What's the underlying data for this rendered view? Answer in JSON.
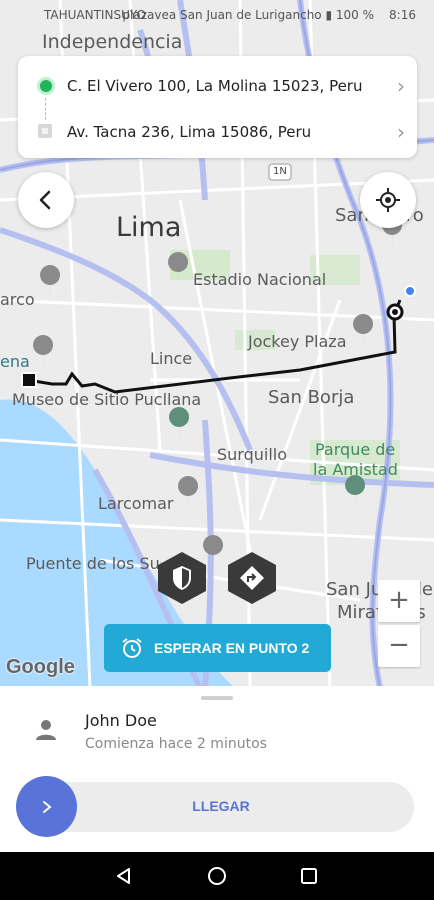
{
  "status_bar": {
    "carrier": "TAHUANTINSUYO",
    "right": "plazavea San Juan de Lurigancho ▮ 100 %",
    "time": "8:16"
  },
  "route": {
    "origin": "C. El Vivero 100, La Molina 15023, Peru",
    "destination": "Av. Tacna 236, Lima 15086, Peru"
  },
  "map": {
    "labels": {
      "independencia": "Independencia",
      "lima": "Lima",
      "san_isidro": "San Isidro",
      "estadio": "Estadio Nacional",
      "arco": "arco",
      "jockey": "Jockey Plaza",
      "lince": "Lince",
      "ena": "ena",
      "museo": "Museo de Sitio Pucllana",
      "san_borja": "San Borja",
      "parque1": "Parque de",
      "parque2": "la Amistad",
      "surquillo": "Surquillo",
      "larcomar": "Larcomar",
      "puente": "Puente de los Suspiros",
      "sjm1": "San Juan de",
      "sjm2": "Miraflores",
      "highway": "1N"
    },
    "zoom_in": "+",
    "zoom_out": "−",
    "attribution": "Google",
    "accent_route": "#111111"
  },
  "wait_button": {
    "label": "ESPERAR EN PUNTO 2"
  },
  "driver": {
    "name": "John Doe",
    "status": "Comienza hace 2 minutos"
  },
  "slider": {
    "label": "LLEGAR"
  },
  "colors": {
    "brand_blue": "#5a73d8",
    "wait_cyan": "#23a9d6",
    "origin_green": "#22b35b"
  }
}
